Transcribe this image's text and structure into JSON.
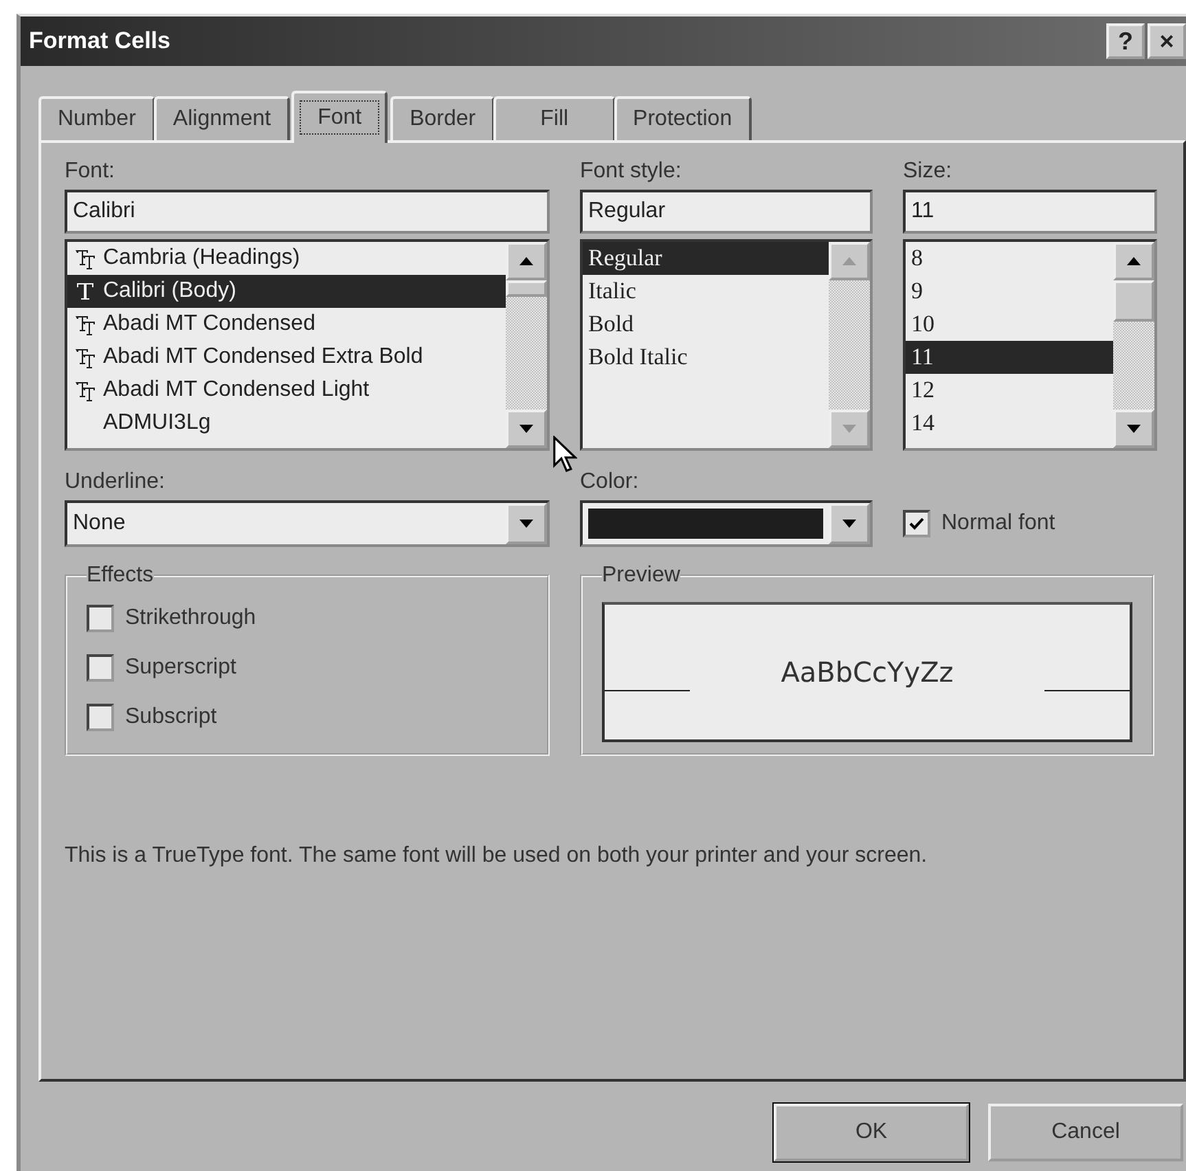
{
  "window": {
    "title": "Format Cells",
    "title_buttons": [
      "?",
      "×"
    ]
  },
  "tabs": [
    {
      "label": "Number",
      "selected": false
    },
    {
      "label": "Alignment",
      "selected": false
    },
    {
      "label": "Font",
      "selected": true
    },
    {
      "label": "Border",
      "selected": false
    },
    {
      "label": "Fill",
      "selected": false
    },
    {
      "label": "Protection",
      "selected": false
    }
  ],
  "font": {
    "label": "Font:",
    "value": "Calibri",
    "items": [
      {
        "name": "Cambria (Headings)",
        "kind": "tt",
        "selected": false
      },
      {
        "name": "Calibri (Body)",
        "kind": "t",
        "selected": true
      },
      {
        "name": "Abadi MT Condensed",
        "kind": "tt",
        "selected": false
      },
      {
        "name": "Abadi MT Condensed Extra Bold",
        "kind": "tt",
        "selected": false
      },
      {
        "name": "Abadi MT Condensed Light",
        "kind": "tt",
        "selected": false
      },
      {
        "name": "ADMUI3Lg",
        "kind": "plain",
        "selected": false
      }
    ]
  },
  "font_style": {
    "label": "Font style:",
    "value": "Regular",
    "disabled_scroll": true,
    "items": [
      {
        "name": "Regular",
        "selected": true
      },
      {
        "name": "Italic",
        "selected": false
      },
      {
        "name": "Bold",
        "selected": false
      },
      {
        "name": "Bold Italic",
        "selected": false
      }
    ]
  },
  "size": {
    "label": "Size:",
    "value": "11",
    "items": [
      {
        "name": "8",
        "selected": false
      },
      {
        "name": "9",
        "selected": false
      },
      {
        "name": "10",
        "selected": false
      },
      {
        "name": "11",
        "selected": true
      },
      {
        "name": "12",
        "selected": false
      },
      {
        "name": "14",
        "selected": false
      }
    ]
  },
  "underline": {
    "label": "Underline:",
    "value": "None"
  },
  "color": {
    "label": "Color:",
    "color": "#1e1e1e"
  },
  "normal_font": {
    "label": "Normal font",
    "checked": true
  },
  "effects": {
    "title": "Effects",
    "items": [
      {
        "label": "Strikethrough",
        "checked": false
      },
      {
        "label": "Superscript",
        "checked": false
      },
      {
        "label": "Subscript",
        "checked": false
      }
    ]
  },
  "preview": {
    "title": "Preview",
    "sample": "AaBbCcYyZz"
  },
  "note": "This is a TrueType font.  The same font will be used on both your printer and your screen.",
  "buttons": [
    "OK",
    "Cancel"
  ]
}
